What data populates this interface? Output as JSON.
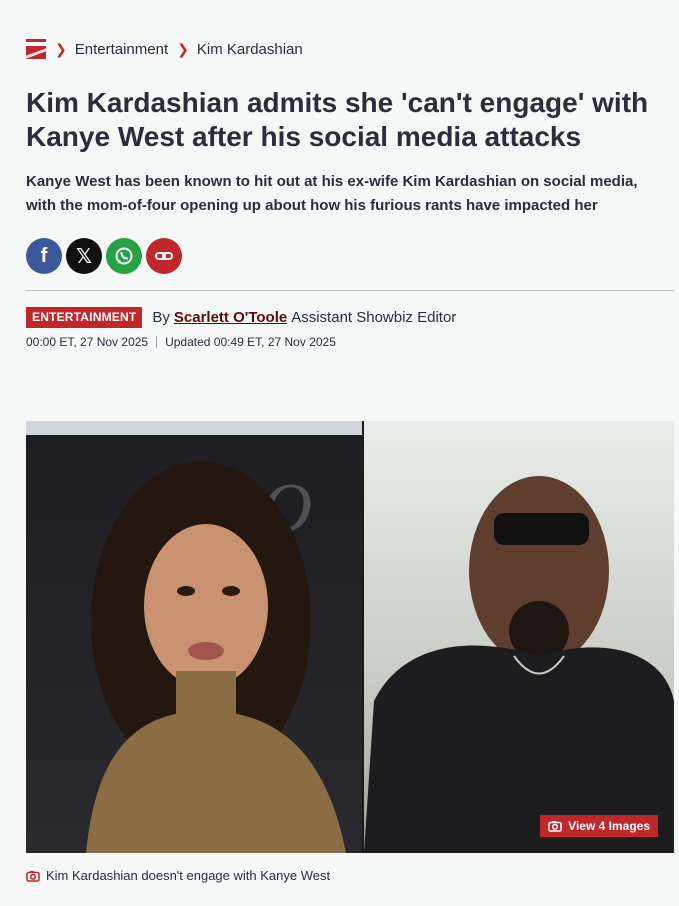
{
  "breadcrumb": {
    "logo_icon": "mirror-logo-icon",
    "items": [
      "Entertainment",
      "Kim Kardashian"
    ]
  },
  "article": {
    "title": "Kim Kardashian admits she 'can't engage' with Kanye West after his social media attacks",
    "subtitle": "Kanye West has been known to hit out at his ex-wife Kim Kardashian on social media, with the mom-of-four opening up about how his furious rants have impacted her"
  },
  "share": {
    "buttons": [
      {
        "name": "facebook",
        "icon": "facebook-icon",
        "color": "#3b5998"
      },
      {
        "name": "x",
        "icon": "x-icon",
        "color": "#111111"
      },
      {
        "name": "whatsapp",
        "icon": "whatsapp-icon",
        "color": "#25a244"
      },
      {
        "name": "copy-link",
        "icon": "link-icon",
        "color": "#c0272d"
      }
    ]
  },
  "byline": {
    "badge": "ENTERTAINMENT",
    "by": "By",
    "author": "Scarlett O'Toole",
    "role": "Assistant Showbiz Editor",
    "published": "00:00 ET, 27 Nov 2025",
    "updated": "Updated 00:49 ET, 27 Nov 2025"
  },
  "media": {
    "view_images_label": "View 4 Images",
    "caption": "Kim Kardashian doesn't engage with Kanye West"
  },
  "colors": {
    "accent": "#c0272d",
    "text": "#2c2c3d",
    "background": "#f6f7f7",
    "author_link": "#5a0d0d"
  }
}
